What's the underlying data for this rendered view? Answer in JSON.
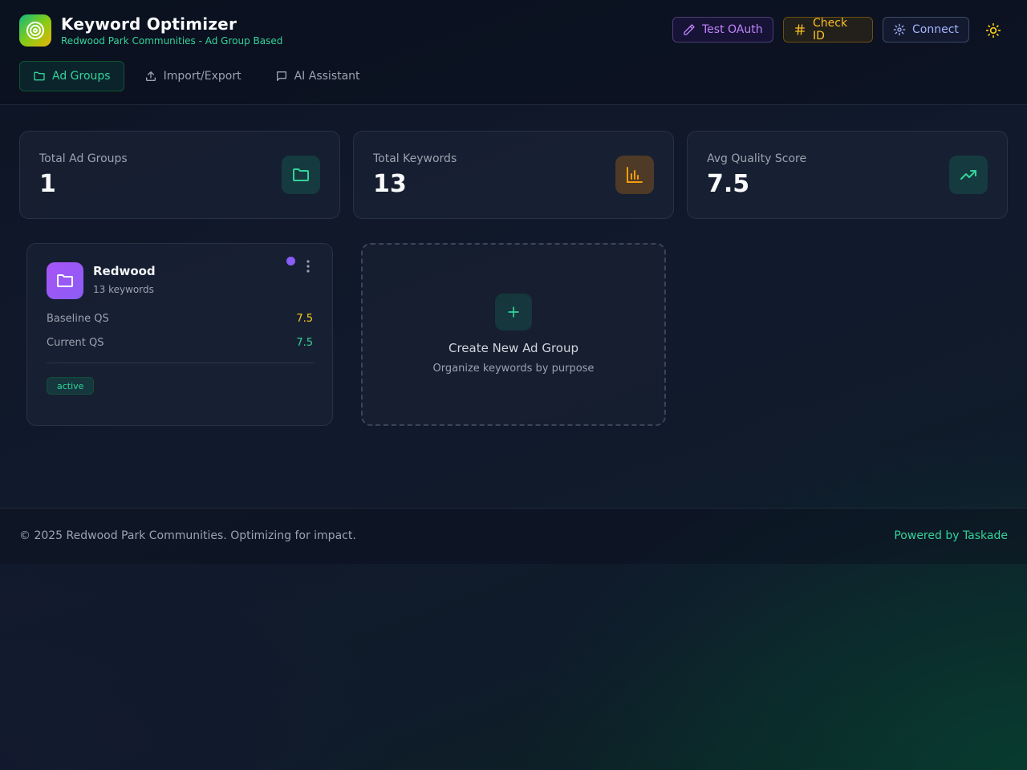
{
  "header": {
    "title": "Keyword Optimizer",
    "subtitle": "Redwood Park Communities - Ad Group Based",
    "logo_icon": "target-icon",
    "buttons": {
      "test_oauth": "Test OAuth",
      "check_id": "Check ID",
      "connect": "Connect"
    },
    "theme_icon": "sun-icon"
  },
  "nav": {
    "tabs": [
      {
        "label": "Ad Groups",
        "icon": "folder-icon",
        "active": true
      },
      {
        "label": "Import/Export",
        "icon": "upload-icon",
        "active": false
      },
      {
        "label": "AI Assistant",
        "icon": "chat-icon",
        "active": false
      }
    ]
  },
  "stats": [
    {
      "label": "Total Ad Groups",
      "value": "1",
      "icon": "folder-icon",
      "color": "#34d399"
    },
    {
      "label": "Total Keywords",
      "value": "13",
      "icon": "bar-chart-icon",
      "color": "#f59e0b"
    },
    {
      "label": "Avg Quality Score",
      "value": "7.5",
      "icon": "trending-up-icon",
      "color": "#34d399"
    }
  ],
  "ad_groups": [
    {
      "name": "Redwood",
      "keyword_count": "13 keywords",
      "dot_color": "#8b5cf6",
      "metrics": [
        {
          "label": "Baseline QS",
          "value": "7.5",
          "color": "#facc15"
        },
        {
          "label": "Current QS",
          "value": "7.5",
          "color": "#34d399"
        }
      ],
      "status": "active"
    }
  ],
  "create_card": {
    "title": "Create New Ad Group",
    "subtitle": "Organize keywords by purpose"
  },
  "footer": {
    "copyright": "© 2025 Redwood Park Communities. Optimizing for impact.",
    "powered_by": "Powered by Taskade"
  },
  "colors": {
    "accent": "#34d399",
    "oauth": "#c084fc",
    "check": "#fbbf24",
    "connect": "#a5b4fc"
  }
}
